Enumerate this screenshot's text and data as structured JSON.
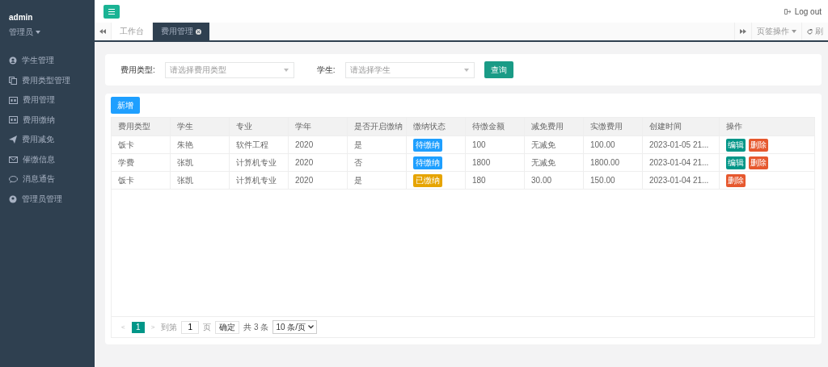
{
  "sidebar": {
    "user": "admin",
    "role": "管理员",
    "items": [
      {
        "label": "学生管理"
      },
      {
        "label": "费用类型管理"
      },
      {
        "label": "费用管理"
      },
      {
        "label": "费用缴纳"
      },
      {
        "label": "费用减免"
      },
      {
        "label": "催缴信息"
      },
      {
        "label": "消息通告"
      },
      {
        "label": "管理员管理"
      }
    ]
  },
  "topbar": {
    "logout": "Log out"
  },
  "tabs": [
    {
      "label": "工作台",
      "selected": false,
      "closable": false
    },
    {
      "label": "费用管理",
      "selected": true,
      "closable": true
    }
  ],
  "tab_tools": {
    "tab_ops": "页签操作",
    "refresh": "刷"
  },
  "filters": [
    {
      "label": "费用类型:",
      "placeholder": "请选择费用类型"
    },
    {
      "label": "学生:",
      "placeholder": "请选择学生"
    }
  ],
  "query_button": "查询",
  "add_button": "新增",
  "table": {
    "columns": [
      "费用类型",
      "学生",
      "专业",
      "学年",
      "是否开启缴纳",
      "缴纳状态",
      "待缴金额",
      "减免费用",
      "实缴费用",
      "创建时间",
      "操作"
    ],
    "rows": [
      {
        "cells": [
          "饭卡",
          "朱艳",
          "软件工程",
          "2020",
          "是"
        ],
        "status": {
          "label": "待缴纳",
          "paid": false
        },
        "rest": [
          "100",
          "无减免",
          "100.00",
          "2023-01-05 21..."
        ],
        "actions": [
          {
            "kind": "edit",
            "label": "编辑"
          },
          {
            "kind": "delete",
            "label": "删除"
          }
        ]
      },
      {
        "cells": [
          "学费",
          "张凯",
          "计算机专业",
          "2020",
          "否"
        ],
        "status": {
          "label": "待缴纳",
          "paid": false
        },
        "rest": [
          "1800",
          "无减免",
          "1800.00",
          "2023-01-04 21..."
        ],
        "actions": [
          {
            "kind": "edit",
            "label": "编辑"
          },
          {
            "kind": "delete",
            "label": "删除"
          }
        ]
      },
      {
        "cells": [
          "饭卡",
          "张凯",
          "计算机专业",
          "2020",
          "是"
        ],
        "status": {
          "label": "已缴纳",
          "paid": true
        },
        "rest": [
          "180",
          "30.00",
          "150.00",
          "2023-01-04 21..."
        ],
        "actions": [
          {
            "kind": "delete",
            "label": "删除"
          }
        ]
      }
    ]
  },
  "pagination": {
    "prev": "<",
    "pages": [
      {
        "label": "1",
        "selected": true
      }
    ],
    "next": ">",
    "goto": "到第",
    "page_value": "1",
    "page_unit": "页",
    "confirm": "确定",
    "total": "共 3 条",
    "page_size": "10 条/页"
  }
}
